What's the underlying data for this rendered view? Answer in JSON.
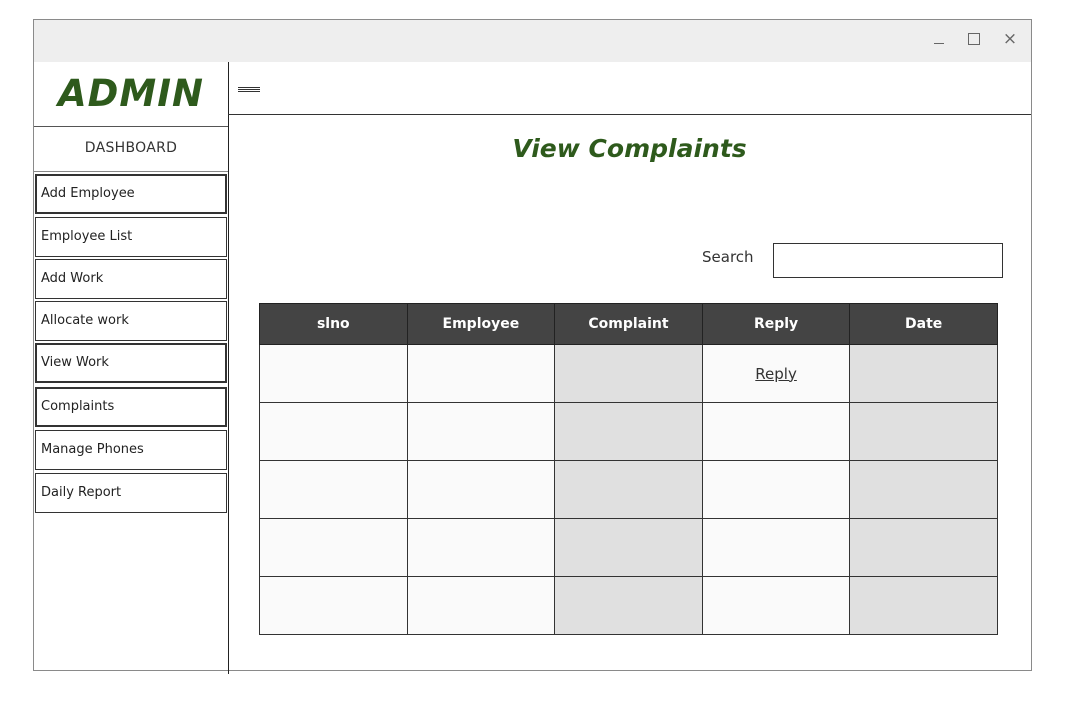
{
  "window": {
    "controls": {
      "minimize": "_",
      "maximize": "□",
      "close": "×"
    }
  },
  "sidebar": {
    "logo": "ADMIN",
    "dashboard": "DASHBOARD",
    "items": [
      {
        "label": "Add Employee"
      },
      {
        "label": "Employee List"
      },
      {
        "label": "Add Work"
      },
      {
        "label": "Allocate work"
      },
      {
        "label": "View Work"
      },
      {
        "label": "Complaints"
      },
      {
        "label": "Manage Phones"
      },
      {
        "label": "Daily Report"
      }
    ]
  },
  "header": {
    "menu_icon": "hamburger-menu-icon"
  },
  "main": {
    "title": "View Complaints",
    "search": {
      "label": "Search",
      "value": "",
      "placeholder": ""
    },
    "table": {
      "columns": [
        "slno",
        "Employee",
        "Complaint",
        "Reply",
        "Date"
      ],
      "rows": [
        [
          "",
          "",
          "",
          "Reply",
          ""
        ],
        [
          "",
          "",
          "",
          "",
          ""
        ],
        [
          "",
          "",
          "",
          "",
          ""
        ],
        [
          "",
          "",
          "",
          "",
          ""
        ],
        [
          "",
          "",
          "",
          "",
          ""
        ]
      ]
    }
  },
  "colors": {
    "brand_green": "#2e5a1c",
    "header_dark": "#444444",
    "shaded_cell": "#e0e0e0"
  }
}
